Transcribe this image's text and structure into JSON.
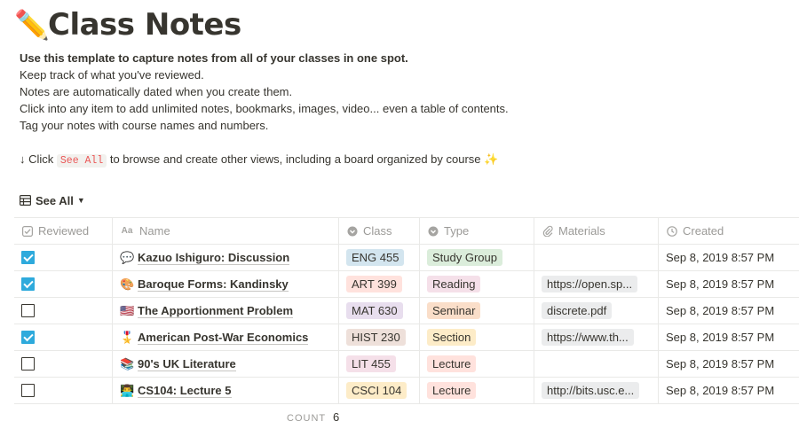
{
  "page": {
    "emoji": "✏️",
    "title": "Class Notes"
  },
  "description": {
    "line1": "Use this template to capture notes from all of your classes in one spot.",
    "line2": "Keep track of what you've reviewed.",
    "line3": "Notes are automatically dated when you create them.",
    "line4": "Click into any item to add unlimited notes, bookmarks, images, video... even a table of contents.",
    "line5": "Tag your notes with course names and numbers.",
    "hint_prefix": "↓ Click",
    "hint_code": "See All",
    "hint_suffix": "to browse and create other views, including a board organized by course",
    "hint_emoji": "✨"
  },
  "view": {
    "label": "See All",
    "icon": "table-icon"
  },
  "columns": [
    {
      "label": "Reviewed",
      "icon": "checkbox-icon"
    },
    {
      "label": "Name",
      "icon": "text-aa-icon"
    },
    {
      "label": "Class",
      "icon": "select-icon"
    },
    {
      "label": "Type",
      "icon": "select-icon"
    },
    {
      "label": "Materials",
      "icon": "paperclip-icon"
    },
    {
      "label": "Created",
      "icon": "clock-icon"
    }
  ],
  "rows": [
    {
      "reviewed": true,
      "emoji": "💬",
      "name": "Kazuo Ishiguro: Discussion",
      "class": "ENG 455",
      "class_color": "#d3e5ef",
      "type": "Study Group",
      "type_color": "#dbeddb",
      "materials": "",
      "created": "Sep 8, 2019 8:57 PM"
    },
    {
      "reviewed": true,
      "emoji": "🎨",
      "name": "Baroque Forms: Kandinsky",
      "class": "ART 399",
      "class_color": "#ffe2dd",
      "type": "Reading",
      "type_color": "#f5e0e9",
      "materials": "https://open.sp...",
      "created": "Sep 8, 2019 8:57 PM"
    },
    {
      "reviewed": false,
      "emoji": "🇺🇸",
      "name": "The Apportionment Problem",
      "class": "MAT 630",
      "class_color": "#e8deee",
      "type": "Seminar",
      "type_color": "#fadec9",
      "materials": "discrete.pdf",
      "created": "Sep 8, 2019 8:57 PM"
    },
    {
      "reviewed": true,
      "emoji": "🎖️",
      "name": "American Post-War Economics",
      "class": "HIST 230",
      "class_color": "#eee0da",
      "type": "Section",
      "type_color": "#fdecc8",
      "materials": "https://www.th...",
      "created": "Sep 8, 2019 8:57 PM"
    },
    {
      "reviewed": false,
      "emoji": "📚",
      "name": "90's UK Literature",
      "class": "LIT 455",
      "class_color": "#f5e0e9",
      "type": "Lecture",
      "type_color": "#ffe2dd",
      "materials": "",
      "created": "Sep 8, 2019 8:57 PM"
    },
    {
      "reviewed": false,
      "emoji": "👨‍💻",
      "name": "CS104: Lecture 5",
      "class": "CSCI 104",
      "class_color": "#fdecc8",
      "type": "Lecture",
      "type_color": "#ffe2dd",
      "materials": "http://bits.usc.e...",
      "created": "Sep 8, 2019 8:57 PM"
    }
  ],
  "footer": {
    "count_label": "COUNT",
    "count_value": "6"
  }
}
